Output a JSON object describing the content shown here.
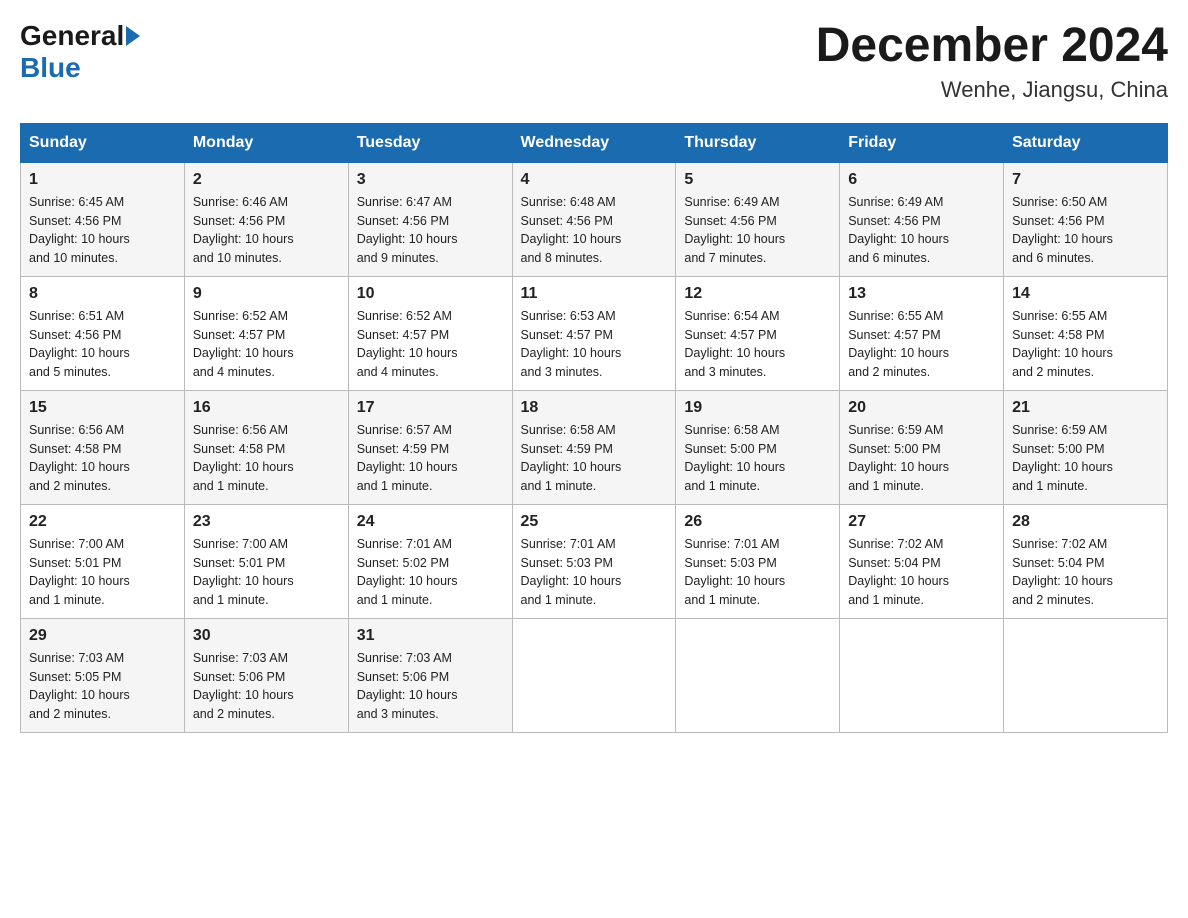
{
  "header": {
    "logo_general": "General",
    "logo_blue": "Blue",
    "main_title": "December 2024",
    "subtitle": "Wenhe, Jiangsu, China"
  },
  "days_of_week": [
    "Sunday",
    "Monday",
    "Tuesday",
    "Wednesday",
    "Thursday",
    "Friday",
    "Saturday"
  ],
  "weeks": [
    [
      {
        "day": "1",
        "sunrise": "6:45 AM",
        "sunset": "4:56 PM",
        "daylight": "10 hours and 10 minutes."
      },
      {
        "day": "2",
        "sunrise": "6:46 AM",
        "sunset": "4:56 PM",
        "daylight": "10 hours and 10 minutes."
      },
      {
        "day": "3",
        "sunrise": "6:47 AM",
        "sunset": "4:56 PM",
        "daylight": "10 hours and 9 minutes."
      },
      {
        "day": "4",
        "sunrise": "6:48 AM",
        "sunset": "4:56 PM",
        "daylight": "10 hours and 8 minutes."
      },
      {
        "day": "5",
        "sunrise": "6:49 AM",
        "sunset": "4:56 PM",
        "daylight": "10 hours and 7 minutes."
      },
      {
        "day": "6",
        "sunrise": "6:49 AM",
        "sunset": "4:56 PM",
        "daylight": "10 hours and 6 minutes."
      },
      {
        "day": "7",
        "sunrise": "6:50 AM",
        "sunset": "4:56 PM",
        "daylight": "10 hours and 6 minutes."
      }
    ],
    [
      {
        "day": "8",
        "sunrise": "6:51 AM",
        "sunset": "4:56 PM",
        "daylight": "10 hours and 5 minutes."
      },
      {
        "day": "9",
        "sunrise": "6:52 AM",
        "sunset": "4:57 PM",
        "daylight": "10 hours and 4 minutes."
      },
      {
        "day": "10",
        "sunrise": "6:52 AM",
        "sunset": "4:57 PM",
        "daylight": "10 hours and 4 minutes."
      },
      {
        "day": "11",
        "sunrise": "6:53 AM",
        "sunset": "4:57 PM",
        "daylight": "10 hours and 3 minutes."
      },
      {
        "day": "12",
        "sunrise": "6:54 AM",
        "sunset": "4:57 PM",
        "daylight": "10 hours and 3 minutes."
      },
      {
        "day": "13",
        "sunrise": "6:55 AM",
        "sunset": "4:57 PM",
        "daylight": "10 hours and 2 minutes."
      },
      {
        "day": "14",
        "sunrise": "6:55 AM",
        "sunset": "4:58 PM",
        "daylight": "10 hours and 2 minutes."
      }
    ],
    [
      {
        "day": "15",
        "sunrise": "6:56 AM",
        "sunset": "4:58 PM",
        "daylight": "10 hours and 2 minutes."
      },
      {
        "day": "16",
        "sunrise": "6:56 AM",
        "sunset": "4:58 PM",
        "daylight": "10 hours and 1 minute."
      },
      {
        "day": "17",
        "sunrise": "6:57 AM",
        "sunset": "4:59 PM",
        "daylight": "10 hours and 1 minute."
      },
      {
        "day": "18",
        "sunrise": "6:58 AM",
        "sunset": "4:59 PM",
        "daylight": "10 hours and 1 minute."
      },
      {
        "day": "19",
        "sunrise": "6:58 AM",
        "sunset": "5:00 PM",
        "daylight": "10 hours and 1 minute."
      },
      {
        "day": "20",
        "sunrise": "6:59 AM",
        "sunset": "5:00 PM",
        "daylight": "10 hours and 1 minute."
      },
      {
        "day": "21",
        "sunrise": "6:59 AM",
        "sunset": "5:00 PM",
        "daylight": "10 hours and 1 minute."
      }
    ],
    [
      {
        "day": "22",
        "sunrise": "7:00 AM",
        "sunset": "5:01 PM",
        "daylight": "10 hours and 1 minute."
      },
      {
        "day": "23",
        "sunrise": "7:00 AM",
        "sunset": "5:01 PM",
        "daylight": "10 hours and 1 minute."
      },
      {
        "day": "24",
        "sunrise": "7:01 AM",
        "sunset": "5:02 PM",
        "daylight": "10 hours and 1 minute."
      },
      {
        "day": "25",
        "sunrise": "7:01 AM",
        "sunset": "5:03 PM",
        "daylight": "10 hours and 1 minute."
      },
      {
        "day": "26",
        "sunrise": "7:01 AM",
        "sunset": "5:03 PM",
        "daylight": "10 hours and 1 minute."
      },
      {
        "day": "27",
        "sunrise": "7:02 AM",
        "sunset": "5:04 PM",
        "daylight": "10 hours and 1 minute."
      },
      {
        "day": "28",
        "sunrise": "7:02 AM",
        "sunset": "5:04 PM",
        "daylight": "10 hours and 2 minutes."
      }
    ],
    [
      {
        "day": "29",
        "sunrise": "7:03 AM",
        "sunset": "5:05 PM",
        "daylight": "10 hours and 2 minutes."
      },
      {
        "day": "30",
        "sunrise": "7:03 AM",
        "sunset": "5:06 PM",
        "daylight": "10 hours and 2 minutes."
      },
      {
        "day": "31",
        "sunrise": "7:03 AM",
        "sunset": "5:06 PM",
        "daylight": "10 hours and 3 minutes."
      },
      null,
      null,
      null,
      null
    ]
  ],
  "labels": {
    "sunrise": "Sunrise:",
    "sunset": "Sunset:",
    "daylight": "Daylight:"
  }
}
